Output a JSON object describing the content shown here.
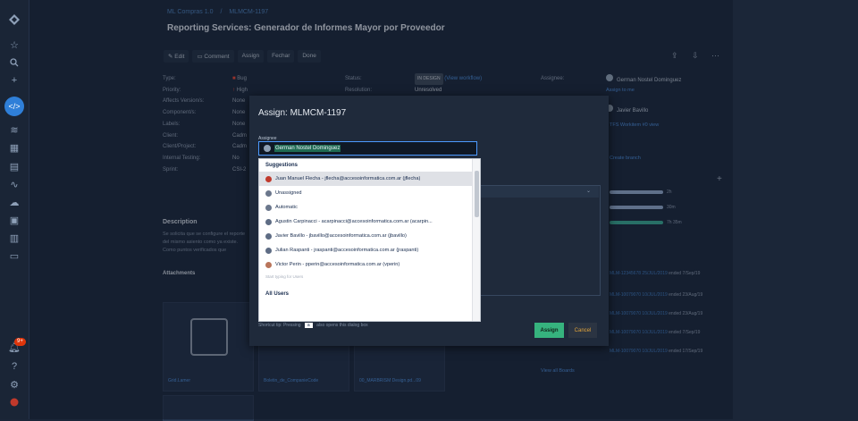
{
  "left_nav": {
    "icons": [
      "jira-logo-icon",
      "star-icon",
      "search-icon",
      "plus-icon",
      "code-icon",
      "filter-icon",
      "grid-icon",
      "list-icon",
      "chart-icon",
      "cloud-icon",
      "board-icon",
      "box-icon",
      "calendar-icon",
      "notification-icon",
      "help-icon",
      "settings-icon",
      "profile-icon"
    ],
    "code_glyph": "</>",
    "notification_badge": "9+"
  },
  "breadcrumb": [
    "ML Compras 1.0",
    "MLMCM-1197"
  ],
  "issue_title": "Reporting Services: Generador de Informes Mayor por Proveedor",
  "toolbar": [
    "Edit",
    "Comment",
    "Assign",
    "Fechar",
    "Done"
  ],
  "details_left": [
    {
      "k": "Type:",
      "v": "Bug"
    },
    {
      "k": "Priority:",
      "v": "High"
    },
    {
      "k": "Affects Version/s:",
      "v": "None"
    },
    {
      "k": "Component/s:",
      "v": "None"
    },
    {
      "k": "Labels:",
      "v": "None"
    },
    {
      "k": "Client:",
      "v": "Cadm"
    },
    {
      "k": "Client/Project:",
      "v": "Cadm"
    },
    {
      "k": "Internal Testing:",
      "v": "No"
    },
    {
      "k": "Sprint:",
      "v": "CSI-2"
    }
  ],
  "details_mid": [
    {
      "k": "Status:",
      "v": "IN DESIGN",
      "link": "(View workflow)"
    },
    {
      "k": "Resolution:",
      "v": "Unresolved"
    }
  ],
  "people": {
    "assignee_label": "Assignee:",
    "assignee_value": "German Nostel Dominguez",
    "assign_to_me": "Assign to me",
    "reporter_value": "Javier Bavillo"
  },
  "description_heading": "Description",
  "description_text": "Se solicita que se configure el reporte del mismo asiento como ya existe. Como puntos verificados que",
  "attachments_heading": "Attachments",
  "attachments": [
    "Grid.Lamer",
    "Boletin_de_CompanieCode",
    "00_MARBRISM Design.pd...09"
  ],
  "time_tracking": [
    "2h",
    "30m",
    "7h 35m"
  ],
  "history": [
    {
      "link": "MLM-12345678 25/JUL/2019",
      "text": "ended 7/Sep/19"
    },
    {
      "link": "MLM-10079070 10/JUL/2019",
      "text": "ended 23/Aug/19"
    },
    {
      "link": "MLM-10079070 10/JUL/2019",
      "text": "ended 23/Aug/19"
    },
    {
      "link": "MLM-10079070 10/JUL/2019",
      "text": "ended 7/Sep/19"
    },
    {
      "link": "MLM-10079070 10/JUL/2019",
      "text": "ended 17/Sep/19"
    }
  ],
  "side_links": [
    "TFS Workitem #0 view",
    "Create branch"
  ],
  "view_all": "View all Boards",
  "modal": {
    "title": "Assign: MLMCM-1197",
    "field_label": "Assignee",
    "input_value": "German Nostel Dominguez",
    "suggestions_heading": "Suggestions",
    "suggestions": [
      "Juan Manuel Flecha - jflecha@accesoinformatica.com.ar (jflecha)",
      "Unassigned",
      "Automatic",
      "Agustin Carpinacci - acarpinacci@accesoinformatica.com.ar (acarpin...",
      "Javier Bavillo - jbavillo@accesoinformatica.com.ar (jbavillo)",
      "Julian Raspanti - jraspanti@accesoinformatica.com.ar (jraspanti)",
      "Victor Perin - pperin@accesoinformatica.com.ar (vperin)"
    ],
    "hint": "Start typing for Users",
    "all_users_heading": "All Users",
    "footer_prefix": "Shortcut tip: Pressing",
    "footer_key": "a",
    "footer_suffix": "also opens this dialog box",
    "assign_label": "Assign",
    "cancel_label": "Cancel"
  }
}
